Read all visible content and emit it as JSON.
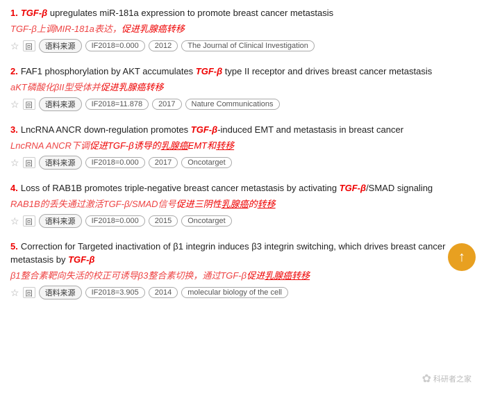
{
  "results": [
    {
      "number": "1.",
      "title_parts": [
        {
          "text": "TGF-β",
          "italic": true,
          "red": true
        },
        {
          "text": " upregulates miR-181a expression to promote breast cancer metastasis",
          "italic": false,
          "red": false
        }
      ],
      "subtitle": "TGF-β上调MIR-181a表达，促进乳腺癌转移",
      "subtitle_parts": [
        {
          "text": "TGF-β上调MIR-181a表达，",
          "italic": false
        },
        {
          "text": "促进乳腺癌转移",
          "italic": true,
          "red": true
        }
      ],
      "source_label": "语料来源",
      "if_label": "IF2018=0.000",
      "year": "2012",
      "journal": "The Journal of Clinical Investigation"
    },
    {
      "number": "2.",
      "title_parts": [
        {
          "text": "FAF1 phosphorylation by AKT accumulates ",
          "italic": false,
          "red": false
        },
        {
          "text": "TGF-β",
          "italic": true,
          "red": true
        },
        {
          "text": " type II receptor and drives breast cancer metastasis",
          "italic": false,
          "red": false
        }
      ],
      "subtitle": "aKT磷酸化βII型受体并促进乳腺癌转移",
      "subtitle_parts": [
        {
          "text": "aKT磷酸化βII型受体并",
          "italic": false
        },
        {
          "text": "促进乳腺癌转移",
          "italic": true,
          "red": true
        }
      ],
      "source_label": "语料来源",
      "if_label": "IF2018=11.878",
      "year": "2017",
      "journal": "Nature Communications"
    },
    {
      "number": "3.",
      "title_parts": [
        {
          "text": "LncRNA ANCR down-regulation promotes ",
          "italic": false,
          "red": false
        },
        {
          "text": "TGF-β",
          "italic": true,
          "red": true
        },
        {
          "text": "-induced EMT and metastasis in breast cancer",
          "italic": false,
          "red": false
        }
      ],
      "subtitle": "LncRNA ANCR下调促进TGF-β诱导的乳腺癌EMT和转移",
      "subtitle_parts": [
        {
          "text": "LncRNA ANCR下调",
          "italic": false
        },
        {
          "text": "促进TGF-β诱导的",
          "italic": true,
          "red": true
        },
        {
          "text": "乳腺癌",
          "italic": true,
          "red": true,
          "underline": true
        },
        {
          "text": "EMT和",
          "italic": true,
          "red": true
        },
        {
          "text": "转移",
          "italic": true,
          "red": true,
          "underline": true
        }
      ],
      "source_label": "语料来源",
      "if_label": "IF2018=0.000",
      "year": "2017",
      "journal": "Oncotarget"
    },
    {
      "number": "4.",
      "title_parts": [
        {
          "text": "Loss of RAB1B promotes triple-negative breast cancer metastasis by activating ",
          "italic": false,
          "red": false
        },
        {
          "text": "TGF-β",
          "italic": true,
          "red": true
        },
        {
          "text": "/SMAD signaling",
          "italic": false,
          "red": false
        }
      ],
      "subtitle": "RAB1B的丢失通过激活TGF-β/SMAD信号促进三阴性乳腺癌的转移",
      "subtitle_parts": [
        {
          "text": "RAB1B的丢失通过激活TGF-β/SMAD信号",
          "italic": false
        },
        {
          "text": "促进三阴性",
          "italic": true,
          "red": true
        },
        {
          "text": "乳腺癌",
          "italic": true,
          "red": true,
          "underline": true
        },
        {
          "text": "的",
          "italic": true,
          "red": true
        },
        {
          "text": "转移",
          "italic": true,
          "red": true,
          "underline": true
        }
      ],
      "source_label": "语料来源",
      "if_label": "IF2018=0.000",
      "year": "2015",
      "journal": "Oncotarget"
    },
    {
      "number": "5.",
      "title_parts": [
        {
          "text": "Correction for Targeted inactivation of β1 integrin induces β3 integrin switching, which drives breast cancer metastasis by ",
          "italic": false,
          "red": false
        },
        {
          "text": "TGF-β",
          "italic": true,
          "red": true
        }
      ],
      "subtitle": "β1整合素靶向失活的校正可诱导β3整合素切换，通过TGF-β促进乳腺癌转移",
      "subtitle_parts": [
        {
          "text": "β1整合素靶向失活的校正可诱导β3整合素切换，通过TGF-β",
          "italic": false
        },
        {
          "text": "促进",
          "italic": true,
          "red": true
        },
        {
          "text": "乳腺癌",
          "italic": true,
          "red": true,
          "underline": true
        },
        {
          "text": "转移",
          "italic": true,
          "red": true,
          "underline": true
        }
      ],
      "source_label": "语料来源",
      "if_label": "IF2018=3.905",
      "year": "2014",
      "journal": "molecular biology of the cell"
    }
  ],
  "icons": {
    "star": "☆",
    "box": "回",
    "up_arrow": "↑",
    "watermark_text": "科研者之家"
  }
}
